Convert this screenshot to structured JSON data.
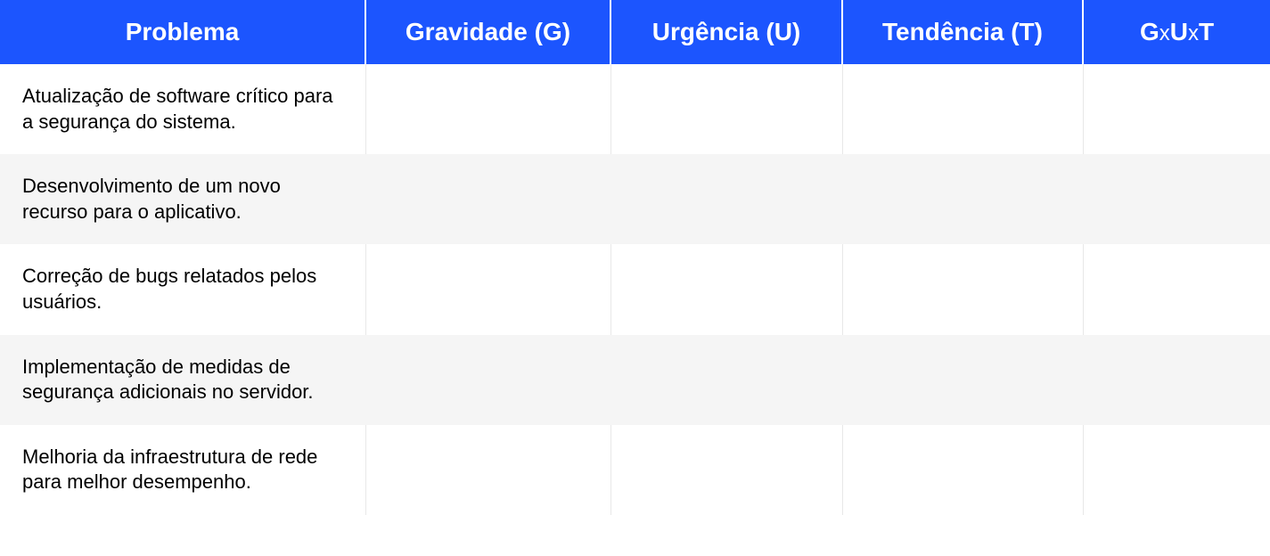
{
  "headers": {
    "problema": "Problema",
    "gravidade": "Gravidade (G)",
    "urgencia": "Urgência (U)",
    "tendencia": "Tendência (T)",
    "gut_g": "G",
    "gut_x1": "x",
    "gut_u": "U",
    "gut_x2": "x",
    "gut_t": "T"
  },
  "rows": [
    {
      "problema": "Atualização de software crítico para a segurança do sistema.",
      "gravidade": "",
      "urgencia": "",
      "tendencia": "",
      "gut": ""
    },
    {
      "problema": "Desenvolvimento de um novo recurso para o aplicativo.",
      "gravidade": "",
      "urgencia": "",
      "tendencia": "",
      "gut": ""
    },
    {
      "problema": "Correção de bugs relatados pelos usuários.",
      "gravidade": "",
      "urgencia": "",
      "tendencia": "",
      "gut": ""
    },
    {
      "problema": "Implementação de medidas de segurança adicionais no servidor.",
      "gravidade": "",
      "urgencia": "",
      "tendencia": "",
      "gut": ""
    },
    {
      "problema": "Melhoria da infraestrutura de rede para melhor desempenho.",
      "gravidade": "",
      "urgencia": "",
      "tendencia": "",
      "gut": ""
    }
  ]
}
